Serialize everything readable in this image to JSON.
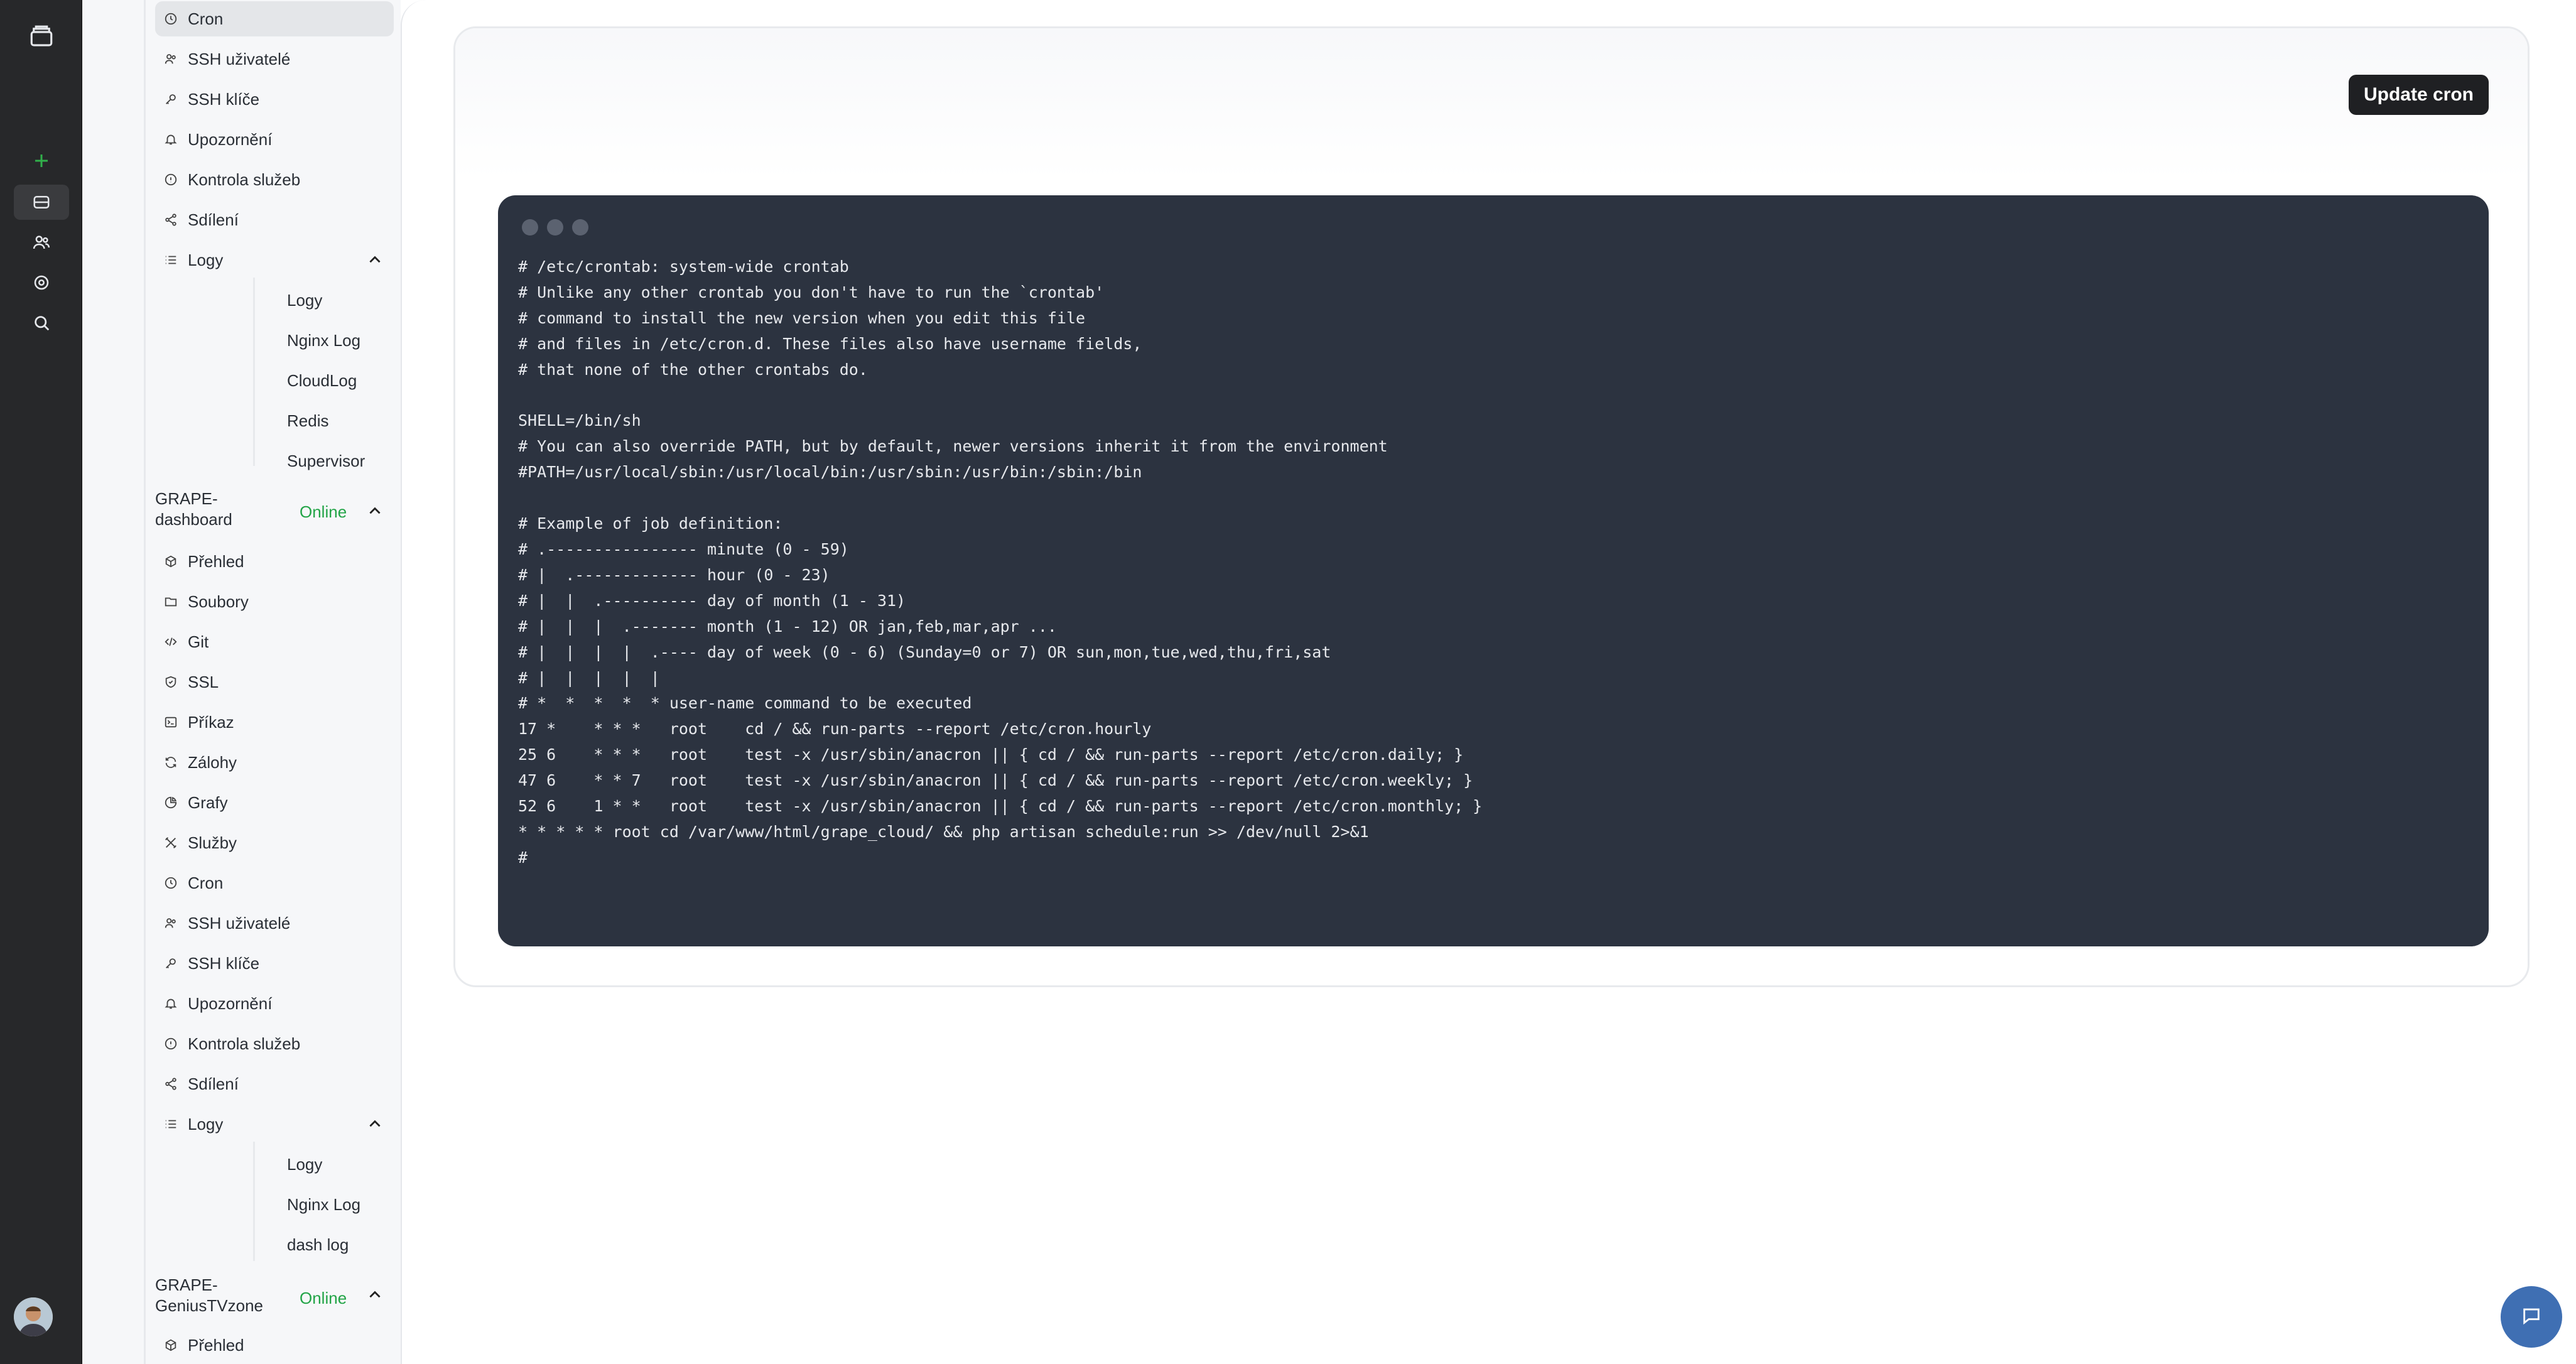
{
  "sidebar": {
    "top_items": [
      {
        "label": "Cron",
        "icon": "clock-icon"
      },
      {
        "label": "SSH uživatelé",
        "icon": "users-icon"
      },
      {
        "label": "SSH klíče",
        "icon": "key-icon"
      },
      {
        "label": "Upozornění",
        "icon": "bell-icon"
      },
      {
        "label": "Kontrola služeb",
        "icon": "alert-circle-icon"
      },
      {
        "label": "Sdílení",
        "icon": "share-icon"
      },
      {
        "label": "Logy",
        "icon": "list-icon"
      }
    ],
    "top_logs": [
      "Logy",
      "Nginx Log",
      "CloudLog",
      "Redis",
      "Supervisor"
    ],
    "server1": {
      "name": "GRAPE-dashboard",
      "status": "Online",
      "items": [
        {
          "label": "Přehled",
          "icon": "box-icon"
        },
        {
          "label": "Soubory",
          "icon": "folder-icon"
        },
        {
          "label": "Git",
          "icon": "code-icon"
        },
        {
          "label": "SSL",
          "icon": "shield-icon"
        },
        {
          "label": "Příkaz",
          "icon": "terminal-icon"
        },
        {
          "label": "Zálohy",
          "icon": "refresh-icon"
        },
        {
          "label": "Grafy",
          "icon": "pie-chart-icon"
        },
        {
          "label": "Služby",
          "icon": "tools-icon"
        },
        {
          "label": "Cron",
          "icon": "clock-icon"
        },
        {
          "label": "SSH uživatelé",
          "icon": "users-icon"
        },
        {
          "label": "SSH klíče",
          "icon": "key-icon"
        },
        {
          "label": "Upozornění",
          "icon": "bell-icon"
        },
        {
          "label": "Kontrola služeb",
          "icon": "alert-circle-icon"
        },
        {
          "label": "Sdílení",
          "icon": "share-icon"
        },
        {
          "label": "Logy",
          "icon": "list-icon"
        }
      ],
      "logs": [
        "Logy",
        "Nginx Log",
        "dash log"
      ]
    },
    "server2": {
      "name": "GRAPE-GeniusTVzone",
      "status": "Online",
      "items": [
        {
          "label": "Přehled",
          "icon": "box-icon"
        }
      ]
    }
  },
  "main": {
    "update_button": "Update cron",
    "crontab": "# /etc/crontab: system-wide crontab\n# Unlike any other crontab you don't have to run the `crontab'\n# command to install the new version when you edit this file\n# and files in /etc/cron.d. These files also have username fields,\n# that none of the other crontabs do.\n\nSHELL=/bin/sh\n# You can also override PATH, but by default, newer versions inherit it from the environment\n#PATH=/usr/local/sbin:/usr/local/bin:/usr/sbin:/usr/bin:/sbin:/bin\n\n# Example of job definition:\n# .---------------- minute (0 - 59)\n# |  .------------- hour (0 - 23)\n# |  |  .---------- day of month (1 - 31)\n# |  |  |  .------- month (1 - 12) OR jan,feb,mar,apr ...\n# |  |  |  |  .---- day of week (0 - 6) (Sunday=0 or 7) OR sun,mon,tue,wed,thu,fri,sat\n# |  |  |  |  |\n# *  *  *  *  * user-name command to be executed\n17 *    * * *   root    cd / && run-parts --report /etc/cron.hourly\n25 6    * * *   root    test -x /usr/sbin/anacron || { cd / && run-parts --report /etc/cron.daily; }\n47 6    * * 7   root    test -x /usr/sbin/anacron || { cd / && run-parts --report /etc/cron.weekly; }\n52 6    1 * *   root    test -x /usr/sbin/anacron || { cd / && run-parts --report /etc/cron.monthly; }\n* * * * * root cd /var/www/html/grape_cloud/ && php artisan schedule:run >> /dev/null 2>&1\n#"
  },
  "colors": {
    "rail": "#27282a",
    "sidebar": "#f6f7f9",
    "online": "#22a447",
    "terminal": "#2c3340",
    "button": "#1f2023",
    "chat": "#3f6fb3"
  }
}
